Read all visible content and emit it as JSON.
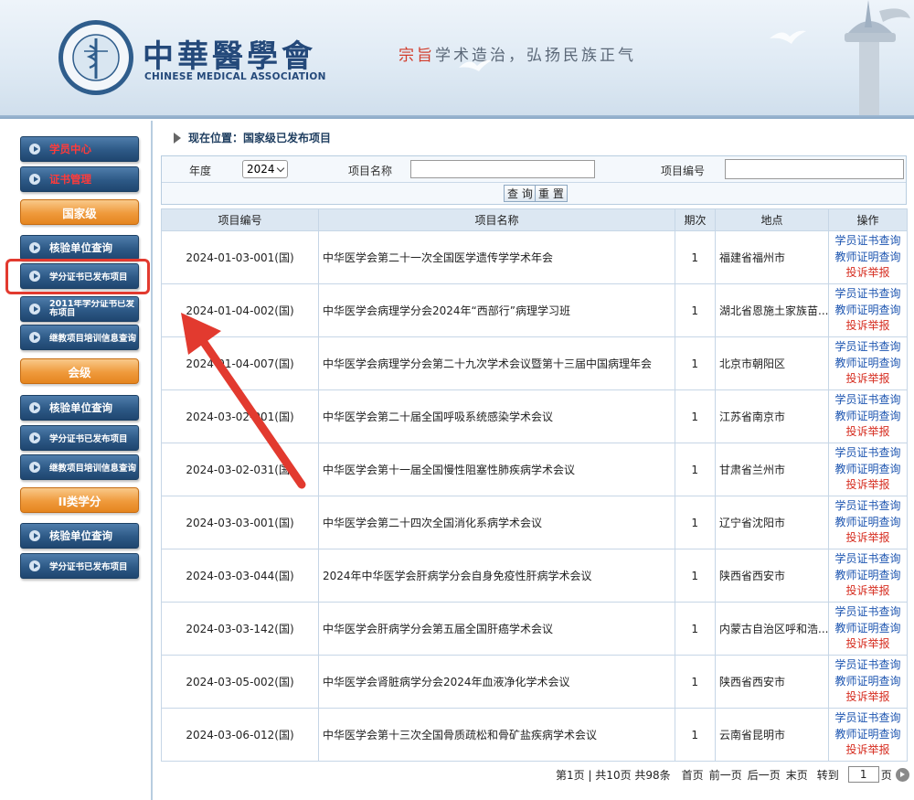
{
  "header": {
    "logo_cn": "中華醫學會",
    "logo_en": "CHINESE MEDICAL ASSOCIATION",
    "seal_text": "中华医学会 1915",
    "slogan_red": "宗旨",
    "slogan_rest": "学术造治，弘扬民族正气"
  },
  "sidebar": {
    "top_items": [
      {
        "label": "学员中心"
      },
      {
        "label": "证书管理"
      }
    ],
    "groups": [
      {
        "heading": "国家级",
        "items": [
          {
            "label": "核验单位查询"
          },
          {
            "label": "学分证书已发布项目"
          },
          {
            "label": "2011年学分证书已发布项目"
          },
          {
            "label": "继教项目培训信息查询"
          }
        ]
      },
      {
        "heading": "会级",
        "items": [
          {
            "label": "核验单位查询"
          },
          {
            "label": "学分证书已发布项目"
          },
          {
            "label": "继教项目培训信息查询"
          }
        ]
      },
      {
        "heading": "II类学分",
        "items": [
          {
            "label": "核验单位查询"
          },
          {
            "label": "学分证书已发布项目"
          }
        ]
      }
    ]
  },
  "breadcrumb": {
    "label": "现在位置：国家级已发布项目"
  },
  "search": {
    "year_label": "年度",
    "year_value": "2024",
    "name_label": "项目名称",
    "name_value": "",
    "code_label": "项目编号",
    "code_value": "",
    "query_button": "查 询",
    "reset_button": "重 置"
  },
  "table": {
    "headers": [
      "项目编号",
      "项目名称",
      "期次",
      "地点",
      "操作"
    ],
    "ops": {
      "student": "学员证书查询",
      "teacher": "教师证明查询",
      "complaint": "投诉举报"
    },
    "rows": [
      {
        "code": "2024-01-03-001(国)",
        "name": "中华医学会第二十一次全国医学遗传学学术年会",
        "period": "1",
        "location": "福建省福州市"
      },
      {
        "code": "2024-01-04-002(国)",
        "name": "中华医学会病理学分会2024年“西部行”病理学习班",
        "period": "1",
        "location": "湖北省恩施土家族苗..."
      },
      {
        "code": "2024-01-04-007(国)",
        "name": "中华医学会病理学分会第二十九次学术会议暨第十三届中国病理年会",
        "period": "1",
        "location": "北京市朝阳区"
      },
      {
        "code": "2024-03-02-001(国)",
        "name": "中华医学会第二十届全国呼吸系统感染学术会议",
        "period": "1",
        "location": "江苏省南京市"
      },
      {
        "code": "2024-03-02-031(国)",
        "name": "中华医学会第十一届全国慢性阻塞性肺疾病学术会议",
        "period": "1",
        "location": "甘肃省兰州市"
      },
      {
        "code": "2024-03-03-001(国)",
        "name": "中华医学会第二十四次全国消化系病学术会议",
        "period": "1",
        "location": "辽宁省沈阳市"
      },
      {
        "code": "2024-03-03-044(国)",
        "name": "2024年中华医学会肝病学分会自身免疫性肝病学术会议",
        "period": "1",
        "location": "陕西省西安市"
      },
      {
        "code": "2024-03-03-142(国)",
        "name": "中华医学会肝病学分会第五届全国肝癌学术会议",
        "period": "1",
        "location": "内蒙古自治区呼和浩..."
      },
      {
        "code": "2024-03-05-002(国)",
        "name": "中华医学会肾脏病学分会2024年血液净化学术会议",
        "period": "1",
        "location": "陕西省西安市"
      },
      {
        "code": "2024-03-06-012(国)",
        "name": "中华医学会第十三次全国骨质疏松和骨矿盐疾病学术会议",
        "period": "1",
        "location": "云南省昆明市"
      }
    ]
  },
  "pager": {
    "info": "第1页 | 共10页 共98条",
    "first": "首页",
    "prev": "前一页",
    "next": "后一页",
    "last": "末页",
    "goto": "转到",
    "page_value": "1",
    "page_suffix": "页"
  },
  "colors": {
    "accent_red": "#e23a2f",
    "nav_blue": "#2d5986",
    "nav_orange": "#ef9a3c",
    "link_blue": "#1d55b0"
  }
}
